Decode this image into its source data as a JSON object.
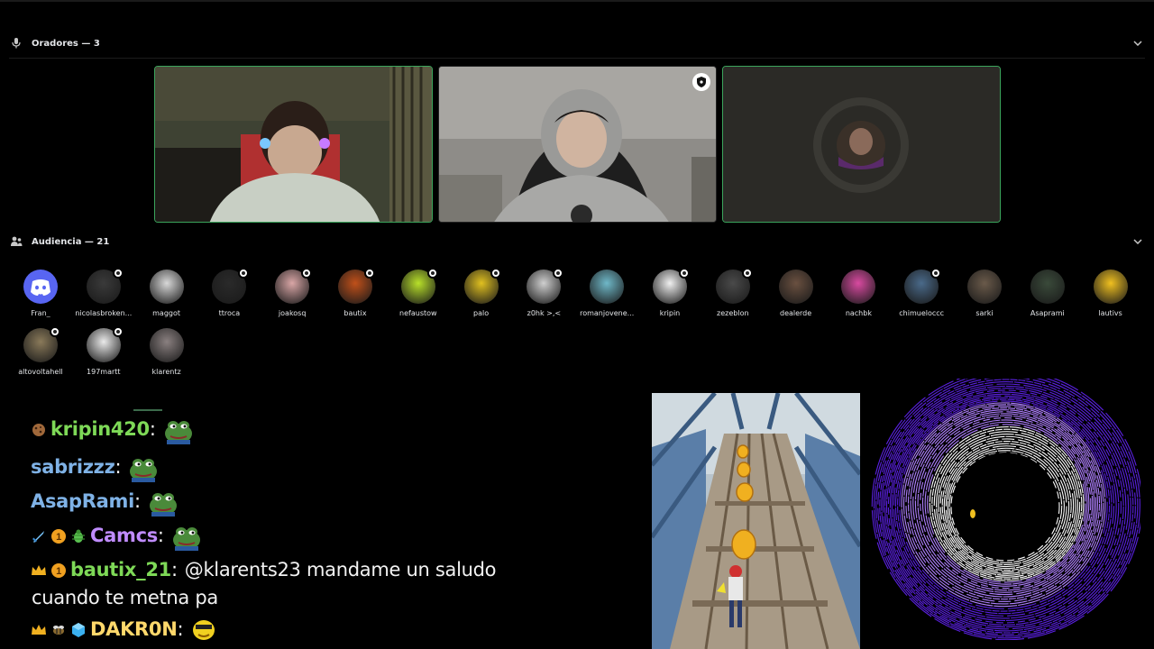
{
  "speakers_section": {
    "title": "Oradores — 3",
    "icon": "microphone-icon",
    "chevron": "chevron-down-icon"
  },
  "speakers": [
    {
      "name": "speaker-video-1",
      "speaking": true,
      "type": "video"
    },
    {
      "name": "speaker-video-2",
      "speaking": false,
      "type": "video",
      "badge": "shield-icon"
    },
    {
      "name": "speaker-avatar-3",
      "speaking": true,
      "type": "avatar"
    }
  ],
  "audience_section": {
    "title": "Audiencia — 21",
    "icon": "audience-icon",
    "chevron": "chevron-down-icon"
  },
  "audience": [
    {
      "name": "Fran_",
      "color": "#5865f2",
      "discord": true,
      "badge": false
    },
    {
      "name": "nicolasbroken...",
      "color": "#3a3a3a",
      "badge": true
    },
    {
      "name": "maggot",
      "color": "#d8d8d8",
      "badge": false
    },
    {
      "name": "ttroca",
      "color": "#2a2a2a",
      "badge": true
    },
    {
      "name": "joakosq",
      "color": "#d9a6a6",
      "badge": true
    },
    {
      "name": "bautix",
      "color": "#c0501a",
      "badge": true
    },
    {
      "name": "nefaustow",
      "color": "#b8e02a",
      "badge": true
    },
    {
      "name": "palo",
      "color": "#e0c020",
      "badge": true
    },
    {
      "name": "z0hk >,<",
      "color": "#cfcfcf",
      "badge": true
    },
    {
      "name": "romanjovene...",
      "color": "#6fb8c8",
      "badge": false
    },
    {
      "name": "kripin",
      "color": "#f0f0f0",
      "badge": true
    },
    {
      "name": "zezeblon",
      "color": "#4a4a4a",
      "badge": true
    },
    {
      "name": "dealerde",
      "color": "#6a5040",
      "badge": false
    },
    {
      "name": "nachbk",
      "color": "#d84aa0",
      "badge": false
    },
    {
      "name": "chimueloccc",
      "color": "#4a6a8a",
      "badge": true
    },
    {
      "name": "sarki",
      "color": "#6a5a4a",
      "badge": false
    },
    {
      "name": "Asaprami",
      "color": "#3a4a3a",
      "badge": false
    },
    {
      "name": "lautivs",
      "color": "#f0c020",
      "badge": false
    },
    {
      "name": "altovoltahell",
      "color": "#8a7a5a",
      "badge": true
    },
    {
      "name": "197martt",
      "color": "#eaeaea",
      "badge": true
    },
    {
      "name": "klarentz",
      "color": "#8a8080",
      "badge": false
    }
  ],
  "chat": {
    "messages": [
      {
        "user": "kripin420",
        "color": "#7ed957",
        "badges": [
          "cookie-icon"
        ],
        "text": "",
        "emote": "pepe-emote"
      },
      {
        "user": "sabrizzz",
        "color": "#7fb2e6",
        "badges": [],
        "text": "",
        "emote": "pepe-emote"
      },
      {
        "user": "AsapRami",
        "color": "#7fb2e6",
        "badges": [],
        "text": "",
        "emote": "pepe-emote"
      },
      {
        "user": "Camcs",
        "color": "#c08cff",
        "badges": [
          "sword-icon",
          "one-badge-icon",
          "bug-icon"
        ],
        "text": "",
        "emote": "pepe-emote"
      },
      {
        "user": "bautix_21",
        "color": "#7ed957",
        "badges": [
          "crown-icon",
          "one-badge-icon"
        ],
        "text": "@klarents23 mandame un saludo",
        "continuation": "cuando te metna pa"
      },
      {
        "user": "DAKR0N",
        "color": "#ffd86b",
        "badges": [
          "crown-icon",
          "bee-icon",
          "cube-icon"
        ],
        "text": "",
        "emote": "yellow-emote"
      }
    ]
  }
}
